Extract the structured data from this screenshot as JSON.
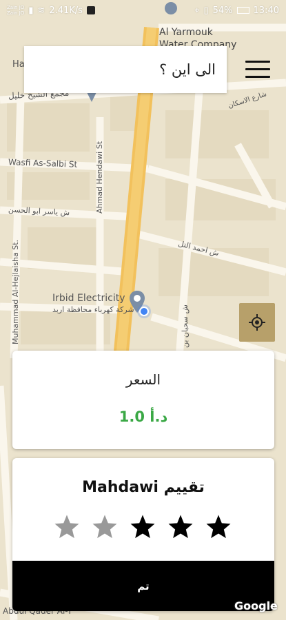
{
  "status_bar": {
    "carrier_top": "Zain JO",
    "carrier_bottom": "Zain JO",
    "network_speed": "2.41K/s",
    "battery": "54%",
    "time": "13:40"
  },
  "search": {
    "placeholder_text": "الى اين ؟"
  },
  "map": {
    "labels": {
      "water_company_1": "Al Yarmouk",
      "water_company_2": "Water Company",
      "complex": "مجمع الشيخ خليل",
      "street_right_top": "شارع الاسكان",
      "wasfi": "Wasfi As-Salbi St",
      "hendawi": "Ahmad Hendawi St",
      "yasser": "ش ياسر ابو الحسن",
      "ahmad_top": "ش احمد التل",
      "hejlaisha": "Muhammad Al-Hejlaisha St.",
      "irbid_electricity": "Irbid Electricity",
      "irbid_electricity_ar": "شركة كهرباء محافظة اربد",
      "right_vertical": "ش سحبان بن",
      "ha": "Ha",
      "qader": "Abdul Qader Al-T"
    }
  },
  "price_card": {
    "title": "السعر",
    "value": "1.0 د.أ"
  },
  "rating_card": {
    "title": "Mahdawi تقييم",
    "stars": [
      {
        "filled": false
      },
      {
        "filled": false
      },
      {
        "filled": true
      },
      {
        "filled": true
      },
      {
        "filled": true
      }
    ],
    "done_label": "تم"
  },
  "google_logo": "Google",
  "colors": {
    "price_green": "#3aa845",
    "main_road": "#f2c15c",
    "locate_button": "#b7a06a",
    "star_filled": "#000000",
    "star_empty": "#999999"
  }
}
